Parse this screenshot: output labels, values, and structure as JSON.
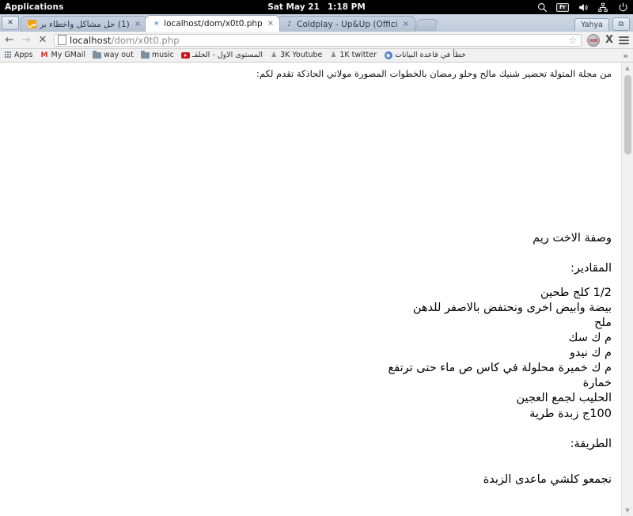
{
  "os_panel": {
    "applications_label": "Applications",
    "date": "Sat May 21",
    "time": "1:18 PM",
    "tray": {
      "search_icon": "search-icon",
      "keyboard_layout": "Fr",
      "volume_icon": "volume-icon",
      "network_icon": "network-icon",
      "power_icon": "power-icon"
    }
  },
  "browser": {
    "system_button_label": "✕",
    "tabs": [
      {
        "title": "(1) حل مشاكل واخطاء بر",
        "favicon": "orange-site-icon",
        "favicon_glyph": "ص",
        "close_label": "×",
        "active": false
      },
      {
        "title": "localhost/dom/x0t0.php",
        "favicon": "loading-spinner-icon",
        "favicon_glyph": "✶",
        "close_label": "×",
        "active": true
      },
      {
        "title": "Coldplay - Up&Up (Offici",
        "favicon": "music-note-icon",
        "favicon_glyph": "♪",
        "close_label": "×",
        "active": false
      }
    ],
    "user_chip_label": "Yahya",
    "window_restore_label": "⧉",
    "toolbar": {
      "back_label": "←",
      "forward_label": "→",
      "stop_label": "✕",
      "url_host": "localhost",
      "url_path": "/dom/x0t0.php",
      "bookmark_star_label": "☆",
      "extension_icon": "extension-icon",
      "close_x_label": "X",
      "menu_icon": "hamburger-menu-icon"
    },
    "bookmarks": [
      {
        "label": "Apps",
        "icon": "apps-grid-icon",
        "rtl": false
      },
      {
        "label": "My GMail",
        "icon": "gmail-icon",
        "rtl": false
      },
      {
        "label": "way out",
        "icon": "folder-icon",
        "rtl": false
      },
      {
        "label": "music",
        "icon": "folder-icon",
        "rtl": false
      },
      {
        "label": "المستوى الاول - الحلقـ",
        "icon": "youtube-icon",
        "rtl": true
      },
      {
        "label": "3K Youtube",
        "icon": "contact-icon",
        "rtl": false
      },
      {
        "label": "1K twitter",
        "icon": "contact-icon",
        "rtl": false
      },
      {
        "label": "خطأ في قاعدة البيانات",
        "icon": "globe-icon",
        "rtl": true
      }
    ],
    "bookmarks_overflow_label": "»"
  },
  "page": {
    "intro_line": "من مجلة المتولة تحضير شنيك مالح وحلو رمضان بالخطوات المصورة مولاتي الحاذكة تقدم لكم:",
    "recipe_title": "وصفة الاخت ريم",
    "ingredients_heading": "المقادير:",
    "ingredients": [
      "1/2 كلج طحين",
      "بيضة وابيض اخرى ونحتفض بالاصفر للدهن",
      "ملح",
      "م ك سك",
      "م ك نيدو",
      "م ك خميرة محلولة في كاس ص ماء حتى ترتفع",
      "خمارة",
      "الحليب لجمع العجين",
      "100ج زبدة طرية"
    ],
    "method_heading": "الطريقة:",
    "method_lines": [
      "نجمعو كلشي ماعدى الزبدة"
    ]
  },
  "scrollbar": {
    "up_arrow": "▲",
    "down_arrow": "▼"
  }
}
